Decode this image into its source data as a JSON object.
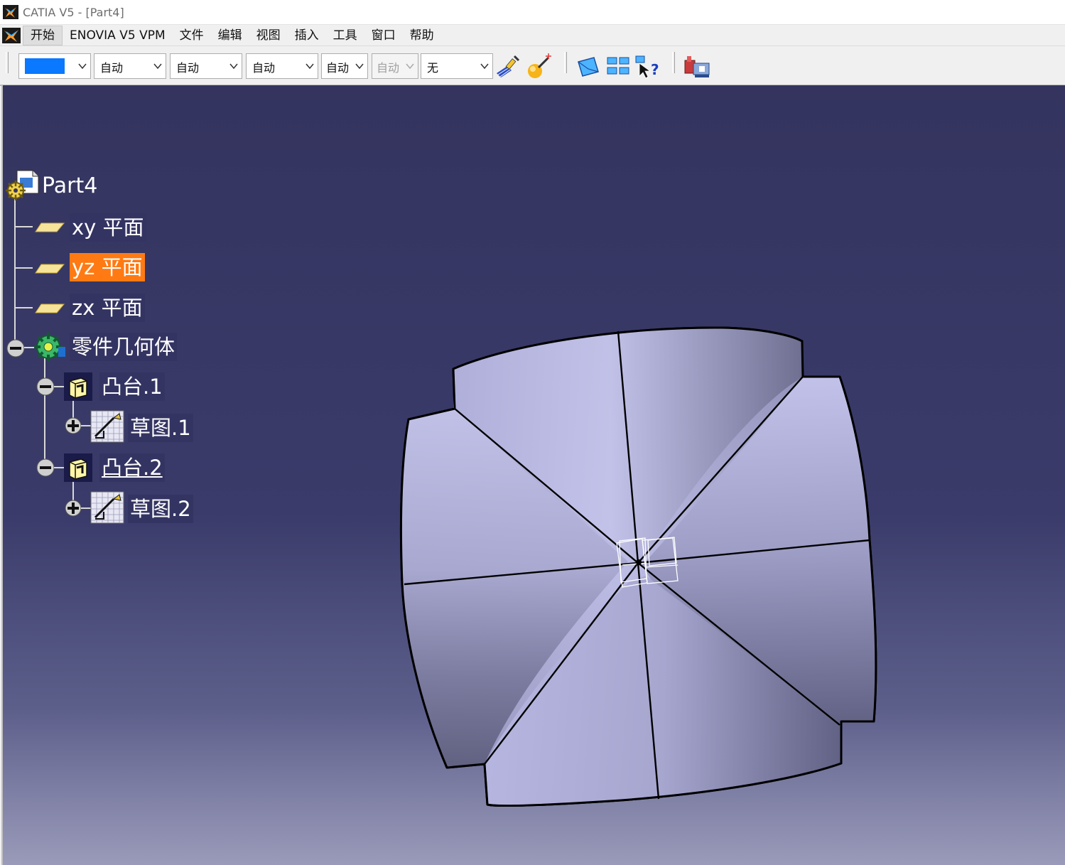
{
  "window": {
    "title": "CATIA V5 - [Part4]"
  },
  "menu": {
    "items": [
      "开始",
      "ENOVIA V5 VPM",
      "文件",
      "编辑",
      "视图",
      "插入",
      "工具",
      "窗口",
      "帮助"
    ]
  },
  "toolbar": {
    "color_value": "#0a78ff",
    "combos": [
      {
        "value": "自动",
        "enabled": true
      },
      {
        "value": "自动",
        "enabled": true
      },
      {
        "value": "自动",
        "enabled": true
      },
      {
        "value": "自动",
        "enabled": true
      },
      {
        "value": "自动",
        "enabled": false
      },
      {
        "value": "无",
        "enabled": true
      }
    ]
  },
  "tree": {
    "root": "Part4",
    "planes": [
      "xy 平面",
      "yz 平面",
      "zx 平面"
    ],
    "selected_plane": "yz 平面",
    "body": "零件几何体",
    "pads": [
      {
        "label": "凸台.1",
        "sketch": "草图.1"
      },
      {
        "label": "凸台.2",
        "sketch": "草图.2"
      }
    ]
  },
  "colors": {
    "viewport_top": "#34345f",
    "viewport_bottom": "#9a9bba",
    "selection": "#ff7a12",
    "part_face": "#b8b8e0"
  }
}
